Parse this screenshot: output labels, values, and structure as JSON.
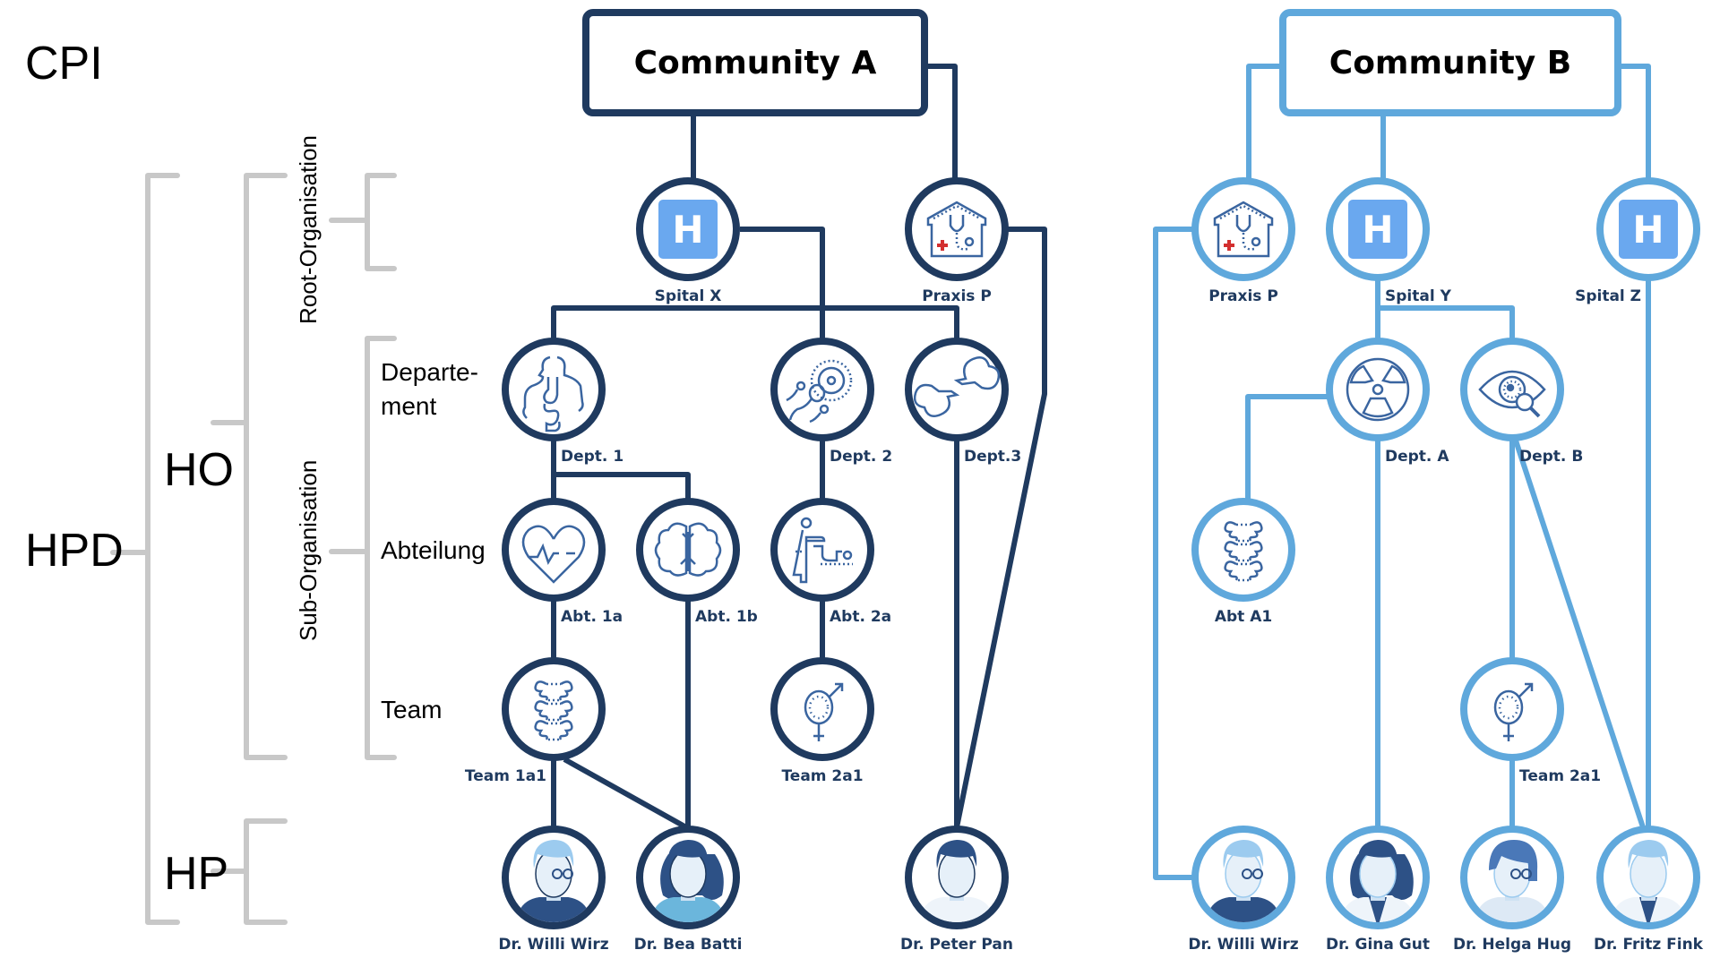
{
  "colors": {
    "community_a": "#1f3a5f",
    "community_b": "#5fa8dc",
    "bracket": "#c8c8c8",
    "hospital_icon_bg": "#6aa8ef",
    "icon_stroke": "#3a65a0",
    "red_cross": "#d32f2f"
  },
  "legend": {
    "cpi": "CPI",
    "hpd": "HPD",
    "ho": "HO",
    "hp": "HP",
    "root_org": "Root-Organisation",
    "sub_org": "Sub-Organisation",
    "departement_line1": "Departe-",
    "departement_line2": "ment",
    "abteilung": "Abteilung",
    "team": "Team"
  },
  "communities": {
    "a": {
      "title": "Community A",
      "nodes": {
        "spital_x": {
          "label": "Spital X",
          "icon": "hospital-icon"
        },
        "praxis_p": {
          "label": "Praxis P",
          "icon": "clinic-stethoscope-icon"
        },
        "dept1": {
          "label": "Dept. 1",
          "icon": "digestive-system-icon"
        },
        "dept2": {
          "label": "Dept. 2",
          "icon": "fertility-sperm-icon"
        },
        "dept3": {
          "label": "Dept.3",
          "icon": "broken-bone-icon"
        },
        "abt1a": {
          "label": "Abt. 1a",
          "icon": "heart-rate-icon"
        },
        "abt1b": {
          "label": "Abt. 1b",
          "icon": "brain-icon"
        },
        "abt2a": {
          "label": "Abt. 2a",
          "icon": "pediatric-care-icon"
        },
        "team1a1": {
          "label": "Team 1a1",
          "icon": "spine-icon"
        },
        "team2a1": {
          "label": "Team 2a1",
          "icon": "gender-symbol-icon"
        },
        "willi": {
          "label": "Dr. Willi Wirz",
          "icon": "doctor-avatar-icon"
        },
        "bea": {
          "label": "Dr. Bea Batti",
          "icon": "doctor-avatar-icon"
        },
        "peter": {
          "label": "Dr. Peter Pan",
          "icon": "doctor-avatar-icon"
        }
      }
    },
    "b": {
      "title": "Community B",
      "nodes": {
        "praxis_p": {
          "label": "Praxis P",
          "icon": "clinic-stethoscope-icon"
        },
        "spital_y": {
          "label": "Spital Y",
          "icon": "hospital-icon"
        },
        "spital_z": {
          "label": "Spital Z",
          "icon": "hospital-icon"
        },
        "depta": {
          "label": "Dept. A",
          "icon": "radiation-icon"
        },
        "deptb": {
          "label": "Dept. B",
          "icon": "eye-exam-icon"
        },
        "abta1": {
          "label": "Abt A1",
          "icon": "spine-icon"
        },
        "team2a1": {
          "label": "Team 2a1",
          "icon": "gender-symbol-icon"
        },
        "willi": {
          "label": "Dr. Willi Wirz",
          "icon": "doctor-avatar-icon"
        },
        "gina": {
          "label": "Dr. Gina Gut",
          "icon": "doctor-avatar-icon"
        },
        "helga": {
          "label": "Dr. Helga Hug",
          "icon": "doctor-avatar-icon"
        },
        "fritz": {
          "label": "Dr. Fritz Fink",
          "icon": "doctor-avatar-icon"
        }
      }
    }
  },
  "hospital_letter": "H"
}
